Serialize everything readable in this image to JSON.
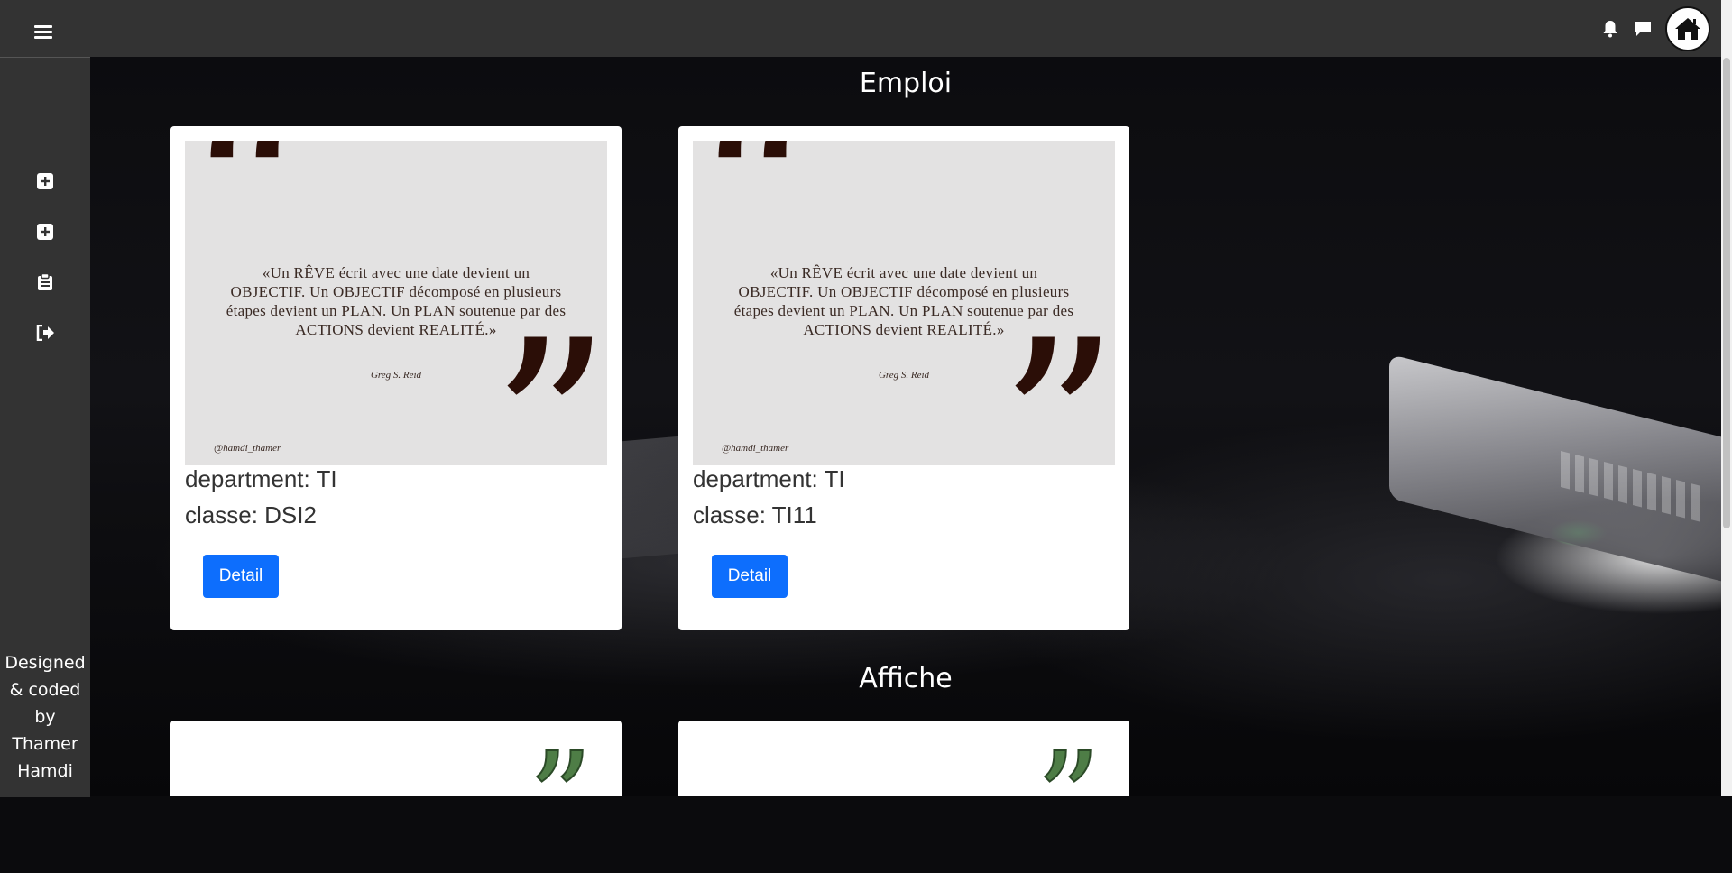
{
  "topbar": {
    "menu_icon": "hamburger-icon",
    "icons": [
      "bell-icon",
      "comment-icon"
    ],
    "home_icon": "home-icon"
  },
  "sidebar": {
    "items": [
      {
        "icon": "plus-square-icon"
      },
      {
        "icon": "plus-square-icon"
      },
      {
        "icon": "clipboard-icon"
      },
      {
        "icon": "sign-out-icon"
      }
    ],
    "credit_lines": [
      "Designed",
      "& coded",
      "by",
      "Thamer",
      "Hamdi"
    ]
  },
  "sections": {
    "emploi_title": "Emploi",
    "affiche_title": "Affiche"
  },
  "quote": {
    "text": "«Un RÊVE écrit avec une date devient un OBJECTIF. Un OBJECTIF décomposé en plusieurs étapes devient un PLAN. Un PLAN soutenue par des ACTIONS devient REALITÉ.»",
    "author": "Greg S. Reid",
    "handle": "@hamdi_thamer"
  },
  "cards": [
    {
      "department": "department: TI",
      "classe": "classe: DSI2",
      "button": "Detail"
    },
    {
      "department": "department: TI",
      "classe": "classe: TI11",
      "button": "Detail"
    }
  ],
  "colors": {
    "topbar": "#333333",
    "sidebar": "#333333",
    "button": "#0d6efd",
    "quote_mark": "#2b0e07",
    "green_quote": "#4e7d46"
  }
}
